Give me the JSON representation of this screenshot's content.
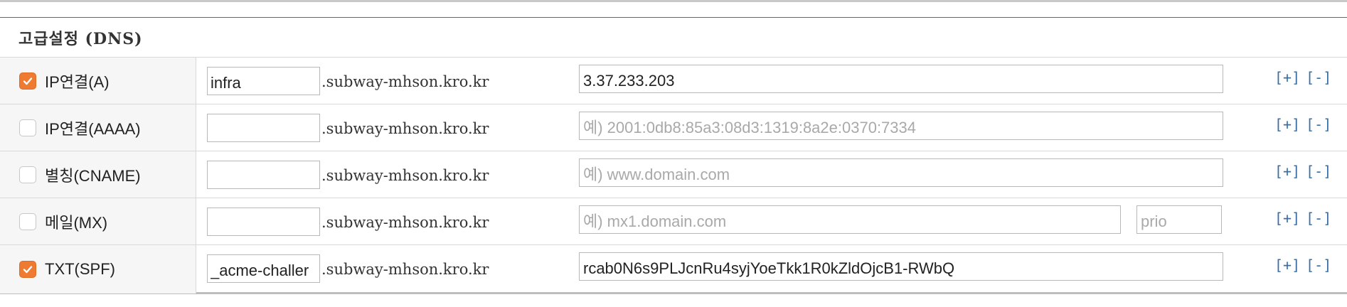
{
  "section": {
    "title": "고급설정 (DNS)"
  },
  "domain_suffix": ".subway-mhson.kro.kr",
  "actions": {
    "add_label": "[+]",
    "remove_label": "[-]"
  },
  "colors": {
    "checkbox_checked": "#ef7a32",
    "action_link": "#3a6ea5"
  },
  "records": [
    {
      "type_label": "IP연결(A)",
      "checked": true,
      "host_value": "infra",
      "host_placeholder": "",
      "value": "3.37.233.203",
      "value_placeholder": ""
    },
    {
      "type_label": "IP연결(AAAA)",
      "checked": false,
      "host_value": "",
      "host_placeholder": "",
      "value": "",
      "value_placeholder": "예) 2001:0db8:85a3:08d3:1319:8a2e:0370:7334"
    },
    {
      "type_label": "별칭(CNAME)",
      "checked": false,
      "host_value": "",
      "host_placeholder": "",
      "value": "",
      "value_placeholder": "예) www.domain.com"
    },
    {
      "type_label": "메일(MX)",
      "checked": false,
      "host_value": "",
      "host_placeholder": "",
      "value": "",
      "value_placeholder": "예) mx1.domain.com",
      "prio_value": "",
      "prio_placeholder": "prio"
    },
    {
      "type_label": "TXT(SPF)",
      "checked": true,
      "host_value": "_acme-challer",
      "host_placeholder": "",
      "value": "rcab0N6s9PLJcnRu4syjYoeTkk1R0kZldOjcB1-RWbQ",
      "value_placeholder": ""
    }
  ]
}
